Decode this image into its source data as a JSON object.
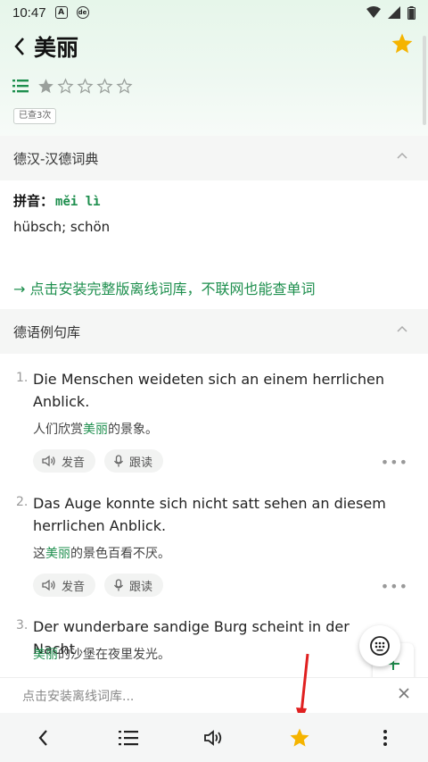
{
  "status_bar": {
    "time": "10:47",
    "icon_a": "A",
    "icon_b": "de"
  },
  "header": {
    "title": "美丽",
    "back_icon": "chevron-left-icon",
    "favorite_icon": "star-filled-icon"
  },
  "rating": {
    "level": 1,
    "max": 5
  },
  "lookup_badge": "已查3次",
  "dictionary": {
    "section_title": "德汉-汉德词典",
    "pinyin_label": "拼音：",
    "pinyin": "měi lì",
    "meaning": "hübsch; schön",
    "install_link": "→ 点击安装完整版离线词库，不联网也能查单词"
  },
  "examples_section": {
    "section_title": "德语例句库",
    "pronounce_label": "发音",
    "follow_label": "跟读",
    "items": [
      {
        "num": "1.",
        "de": "Die Menschen weideten sich an einem herrlichen Anblick.",
        "zh_before": "人们欣赏",
        "zh_hl": "美丽",
        "zh_after": "的景象。"
      },
      {
        "num": "2.",
        "de": "Das Auge konnte sich nicht satt sehen an diesem herrlichen Anblick.",
        "zh_before": "这",
        "zh_hl": "美丽",
        "zh_after": "的景色百看不厌。"
      },
      {
        "num": "3.",
        "de": "Der wunderbare sandige Burg scheint in der Nacht",
        "zh_before": "",
        "zh_hl": "美丽",
        "zh_after": "的沙堡在夜里发光。"
      }
    ]
  },
  "install_bar": {
    "text": "点击安装离线词库..."
  },
  "bottom_nav": [
    "back-icon",
    "list-icon",
    "speaker-icon",
    "star-icon",
    "more-icon"
  ],
  "colors": {
    "accent_green": "#1e8f4e",
    "star_gold": "#f5b400",
    "arrow_red": "#e02020"
  }
}
